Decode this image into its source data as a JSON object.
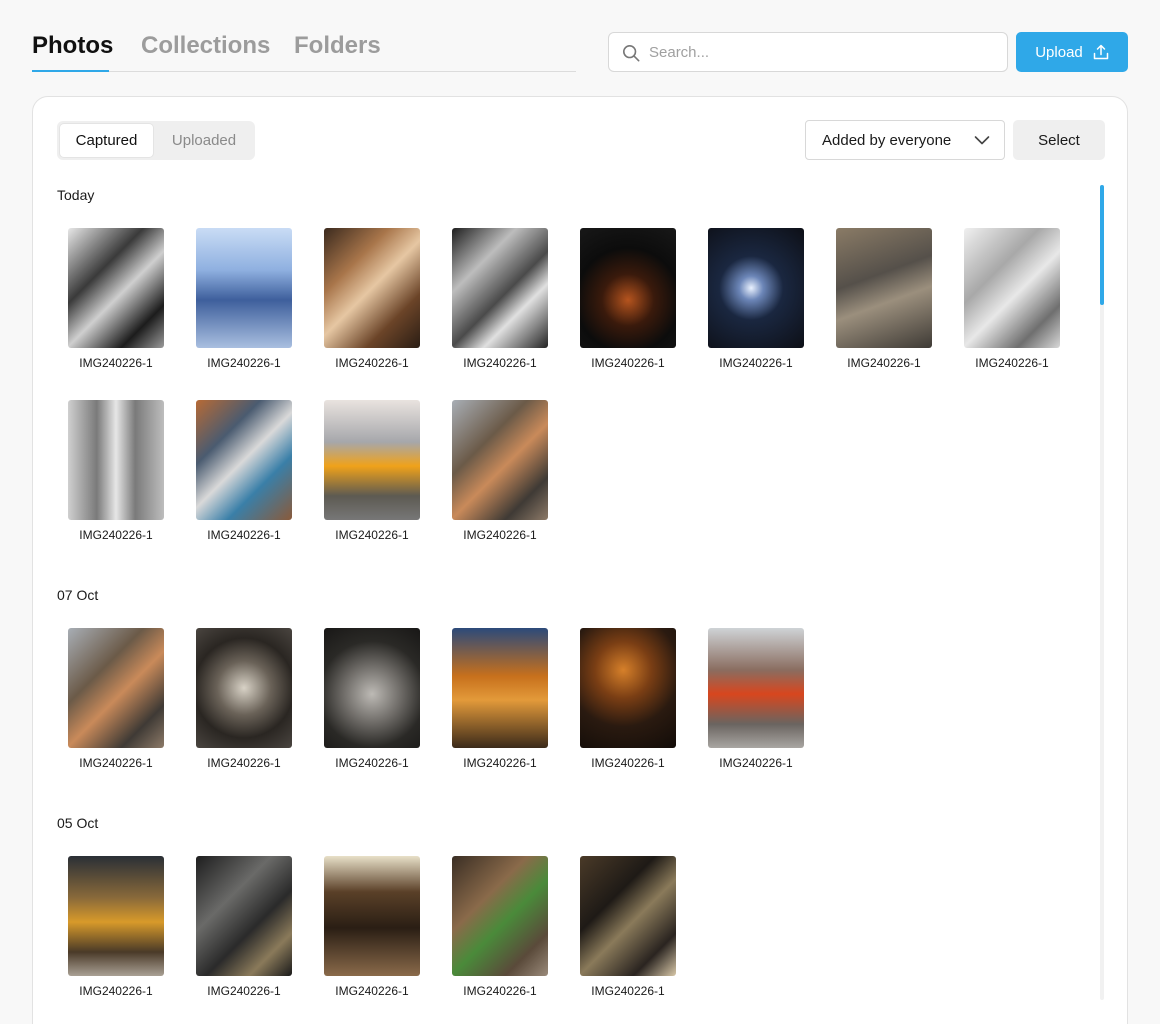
{
  "nav": {
    "tabs": [
      {
        "label": "Photos",
        "active": true
      },
      {
        "label": "Collections",
        "active": false
      },
      {
        "label": "Folders",
        "active": false
      }
    ]
  },
  "search": {
    "placeholder": "Search...",
    "value": ""
  },
  "upload": {
    "label": "Upload"
  },
  "toolbar": {
    "segments": [
      {
        "label": "Captured",
        "active": true
      },
      {
        "label": "Uploaded",
        "active": false
      }
    ],
    "filter": {
      "selected": "Added by everyone"
    },
    "select_label": "Select"
  },
  "colors": {
    "accent": "#2fa8e8"
  },
  "groups": [
    {
      "label": "Today",
      "photos": [
        {
          "name": "IMG240226-1",
          "bg": "linear-gradient(135deg,#e8e8e8 0%,#3a3a3a 35%,#cfcfcf 55%,#1c1c1c 80%,#9a9a9a 100%)"
        },
        {
          "name": "IMG240226-1",
          "bg": "linear-gradient(180deg,#c9dcf5 0%,#8fb0e0 35%,#3e5f9c 60%,#a9bfe0 100%)"
        },
        {
          "name": "IMG240226-1",
          "bg": "linear-gradient(135deg,#3b2a1e 0%,#a8754a 30%,#e6c7a3 50%,#6b4428 75%,#2a1d14 100%)"
        },
        {
          "name": "IMG240226-1",
          "bg": "linear-gradient(135deg,#1e1e1e 0%,#bdbdbd 30%,#4a4a4a 55%,#e0e0e0 70%,#222 100%)"
        },
        {
          "name": "IMG240226-1",
          "bg": "radial-gradient(circle at 50% 60%,#b5541e 0%,#3a1a0c 30%,#0c0c0c 60%,#181818 100%)"
        },
        {
          "name": "IMG240226-1",
          "bg": "radial-gradient(circle at 45% 50%,#eaf2ff 0%,#6c86b8 15%,#1a2740 40%,#0d0f16 100%)"
        },
        {
          "name": "IMG240226-1",
          "bg": "linear-gradient(160deg,#8a7b66 0%,#55504a 40%,#9b8f7d 60%,#3e3a35 100%)"
        },
        {
          "name": "IMG240226-1",
          "bg": "linear-gradient(135deg,#f0f0f0 0%,#a8a8a8 35%,#e8e8e8 55%,#6f6f6f 80%,#d8d8d8 100%)"
        }
      ]
    },
    {
      "label": "",
      "photos": [
        {
          "name": "IMG240226-1",
          "bg": "linear-gradient(90deg,#cfcfcf 0%,#7a7a7a 30%,#e6e6e6 50%,#7a7a7a 70%,#bdbdbd 100%)"
        },
        {
          "name": "IMG240226-1",
          "bg": "linear-gradient(135deg,#b76a35 0%,#4a5b70 30%,#d9d9d9 50%,#3a7fa8 70%,#8a5a3a 100%)"
        },
        {
          "name": "IMG240226-1",
          "bg": "linear-gradient(180deg,#e9e3df 0%,#a6a7ab 35%,#f0a21a 55%,#5d5a52 80%,#777 100%)"
        },
        {
          "name": "IMG240226-1",
          "bg": "linear-gradient(135deg,#a8aeb5 0%,#6b5a48 35%,#c98a5a 55%,#3f3a35 80%,#8d7a68 100%)"
        }
      ]
    },
    {
      "label": "07 Oct",
      "photos": [
        {
          "name": "IMG240226-1",
          "bg": "linear-gradient(135deg,#a8aeb5 0%,#6b5a48 35%,#c98a5a 55%,#3f3a35 80%,#8d7a68 100%)"
        },
        {
          "name": "IMG240226-1",
          "bg": "radial-gradient(circle at 50% 50%,#d8d2c6 0%,#6a6258 35%,#2a2622 65%,#4a4540 100%)"
        },
        {
          "name": "IMG240226-1",
          "bg": "radial-gradient(circle at 50% 55%,#bdbab5 0%,#6f6c68 35%,#2a2926 65%,#181716 100%)"
        },
        {
          "name": "IMG240226-1",
          "bg": "linear-gradient(180deg,#2c4a7a 0%,#c7701c 40%,#e39a3a 60%,#3b2a1a 100%)"
        },
        {
          "name": "IMG240226-1",
          "bg": "radial-gradient(circle at 45% 35%,#d6802a 0%,#7a3e14 30%,#2a1a10 60%,#120c08 100%)"
        },
        {
          "name": "IMG240226-1",
          "bg": "linear-gradient(180deg,#cfd3d6 0%,#8a6d60 35%,#d8461e 55%,#6a6460 80%,#a9a6a2 100%)"
        }
      ]
    },
    {
      "label": "05 Oct",
      "photos": [
        {
          "name": "IMG240226-1",
          "bg": "linear-gradient(180deg,#2a2f36 0%,#8a6a3a 35%,#d89a2a 55%,#4a3a28 80%,#a9a094 100%)"
        },
        {
          "name": "IMG240226-1",
          "bg": "linear-gradient(135deg,#1e1e1e 0%,#6a6a68 35%,#2a2a2a 60%,#8a7a5a 80%,#1a1a1a 100%)"
        },
        {
          "name": "IMG240226-1",
          "bg": "linear-gradient(180deg,#e8e0c8 0%,#5a4028 30%,#2a1e14 60%,#8a6a4a 100%)"
        },
        {
          "name": "IMG240226-1",
          "bg": "linear-gradient(135deg,#3a2e24 0%,#8a6a4a 35%,#4a8a3a 55%,#5a4a3a 80%,#9a8a7a 100%)"
        },
        {
          "name": "IMG240226-1",
          "bg": "linear-gradient(135deg,#4a3a28 0%,#1e1a16 35%,#8a7a5a 55%,#2a2420 80%,#d8c8a8 100%)"
        }
      ]
    }
  ]
}
